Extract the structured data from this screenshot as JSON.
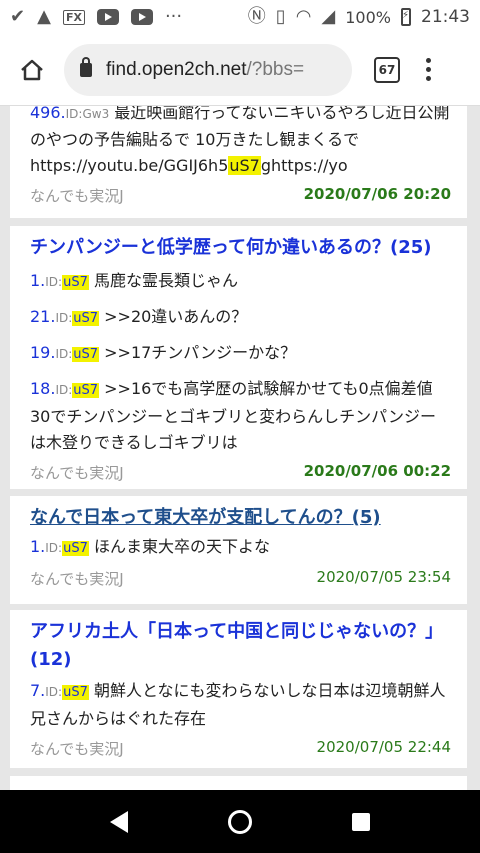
{
  "status": {
    "battery": "100%",
    "time": "21:43",
    "fx_label": "FX"
  },
  "url": {
    "host": "find.open2ch.net",
    "path": "/?bbs=",
    "tab_count": "67"
  },
  "cards": [
    {
      "posts": [
        {
          "num": "496.",
          "id_label": "ID:",
          "id": "Gw3",
          "text1": " 最近映画館行ってないニキいるやろし近日公開のやつの予告編貼るで 10万きたし観まくるで https://youtu.be/GGIJ6h5",
          "hl": "uS7",
          "text2": "ghttps://yo"
        }
      ],
      "board": "なんでも実況J",
      "date": "2020/07/06 20:20"
    },
    {
      "title": "チンパンジーと低学歴って何か違いあるの？",
      "count": "(25)",
      "posts": [
        {
          "num": "1.",
          "id_label": "ID:",
          "id": "uS7",
          "text": " 馬鹿な霊長類じゃん"
        },
        {
          "num": "21.",
          "id_label": "ID:",
          "id": "uS7",
          "text": " >>20違いあんの？"
        },
        {
          "num": "19.",
          "id_label": "ID:",
          "id": "uS7",
          "text": " >>17チンパンジーかな？"
        },
        {
          "num": "18.",
          "id_label": "ID:",
          "id": "uS7",
          "text": " >>16でも高学歴の試験解かせても0点偏差値30でチンパンジーとゴキブリと変わらんしチンパンジーは木登りできるしゴキブリは"
        }
      ],
      "board": "なんでも実況J",
      "date": "2020/07/06 00:22"
    },
    {
      "title": "なんで日本って東大卒が支配してんの？",
      "count": "(5)",
      "posts": [
        {
          "num": "1.",
          "id_label": "ID:",
          "id": "uS7",
          "text": " ほんま東大卒の天下よな"
        }
      ],
      "board": "なんでも実況J",
      "date": "2020/07/05 23:54"
    },
    {
      "title": "アフリカ土人「日本って中国と同じじゃないの？」",
      "count": "(12)",
      "posts": [
        {
          "num": "7.",
          "id_label": "ID:",
          "id": "uS7",
          "text": " 朝鮮人となにも変わらないしな日本は辺境朝鮮人兄さんからはぐれた存在"
        }
      ],
      "board": "なんでも実況J",
      "date": "2020/07/05 22:44"
    }
  ]
}
